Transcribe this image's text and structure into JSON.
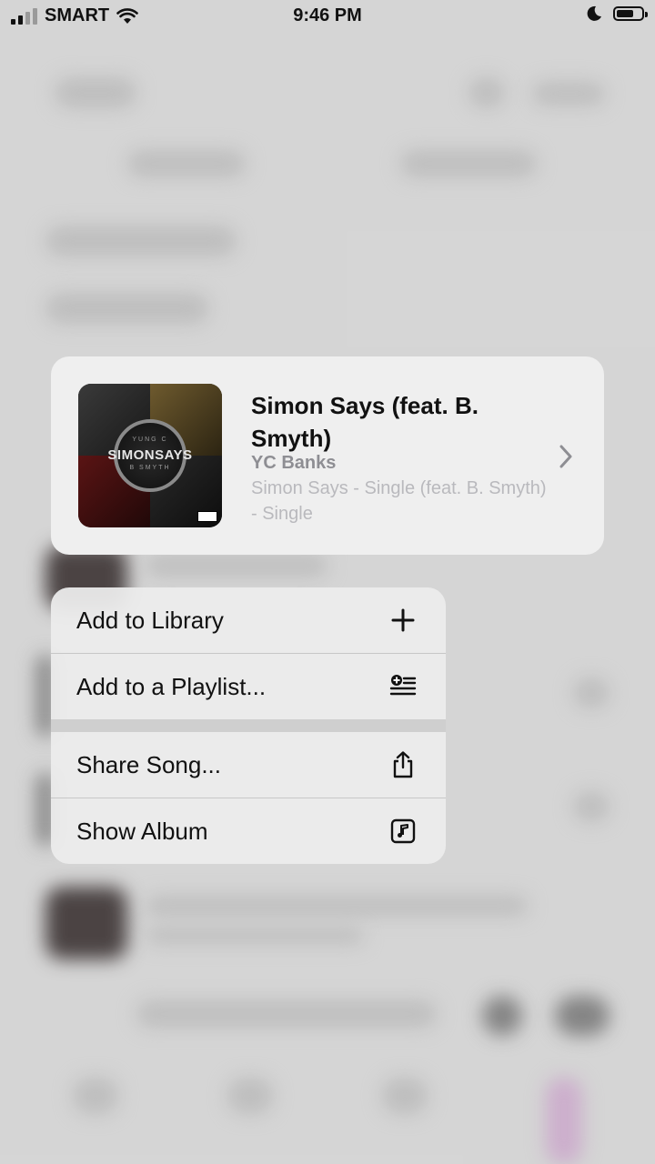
{
  "status_bar": {
    "carrier": "SMART",
    "time": "9:46 PM"
  },
  "song": {
    "title": "Simon Says (feat. B. Smyth)",
    "artist": "YC Banks",
    "album": "Simon Says - Single (feat. B. Smyth) - Single",
    "artwork": {
      "artist_text": "YUNG C",
      "title_text": "SIMONSAYS",
      "featuring_text": "B SMYTH"
    }
  },
  "menu": {
    "items": [
      {
        "label": "Add to Library",
        "icon": "plus-icon"
      },
      {
        "label": "Add to a Playlist...",
        "icon": "add-to-playlist-icon"
      },
      {
        "label": "Share Song...",
        "icon": "share-icon"
      },
      {
        "label": "Show Album",
        "icon": "music-note-square-icon"
      }
    ]
  }
}
